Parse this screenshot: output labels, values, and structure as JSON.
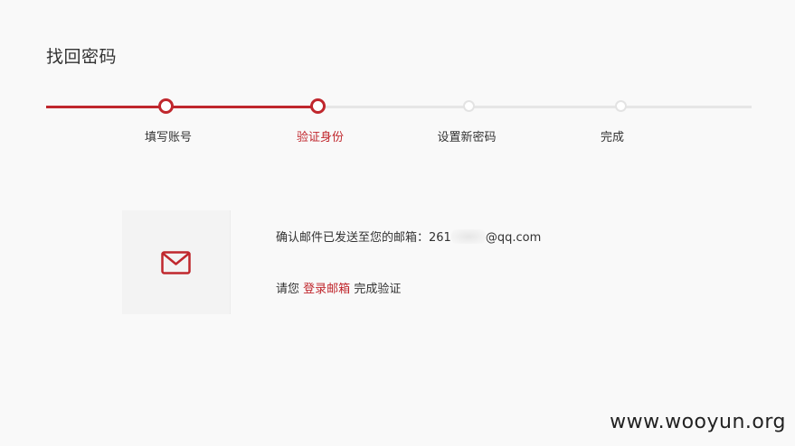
{
  "page": {
    "title": "找回密码"
  },
  "steps": [
    {
      "label": "填写账号",
      "state": "done"
    },
    {
      "label": "验证身份",
      "state": "active"
    },
    {
      "label": "设置新密码",
      "state": "todo"
    },
    {
      "label": "完成",
      "state": "todo"
    }
  ],
  "colors": {
    "accent": "#c0272d",
    "track": "#e6e6e6",
    "background": "#f9f9f9"
  },
  "message": {
    "confirm_prefix": "确认邮件已发送至您的邮箱：",
    "email_visible_start": "261",
    "email_visible_end": "@qq.com",
    "verify_prefix": "请您",
    "login_link": "登录邮箱",
    "verify_suffix": "完成验证"
  },
  "icons": {
    "mail": "envelope-icon"
  },
  "watermark": "www.wooyun.org"
}
